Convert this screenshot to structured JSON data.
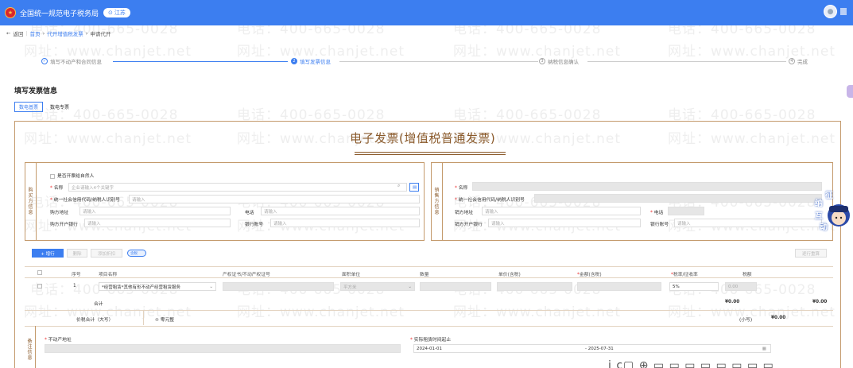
{
  "header": {
    "title": "全国统一规范电子税务局",
    "region": "江苏"
  },
  "breadcrumb": {
    "back": "返回",
    "items": [
      "首页",
      "代开增值税发票",
      "申请代开"
    ]
  },
  "steps": [
    {
      "index": "✓",
      "label": "填写不动产和合同信息"
    },
    {
      "index": "2",
      "label": "填写发票信息"
    },
    {
      "index": "3",
      "label": "纳税信息确认"
    },
    {
      "index": "4",
      "label": "完成"
    }
  ],
  "section_title": "填写发票信息",
  "tabs": {
    "active": "数电普票",
    "inactive": "数电专票"
  },
  "invoice_title": "电子发票(增值税普通发票)",
  "buyer": {
    "label": "购买方信息",
    "natural_person": "是否开票给自然人",
    "name_label": "名称",
    "name_placeholder": "企业请输入4个关键字",
    "tax_id_label": "统一社会信用代码/纳税人识别号",
    "tax_id_placeholder": "请输入",
    "address_label": "购方地址",
    "address_placeholder": "请输入",
    "phone_label": "电话",
    "phone_placeholder": "请输入",
    "bank_label": "购方开户银行",
    "bank_placeholder": "请输入",
    "account_label": "银行账号",
    "account_placeholder": "请输入"
  },
  "seller": {
    "label": "销售方信息",
    "name_label": "名称",
    "tax_id_label": "统一社会信用代码/纳税人识别号",
    "address_label": "销方地址",
    "address_placeholder": "请输入",
    "phone_label": "电话",
    "bank_label": "销方开户银行",
    "bank_placeholder": "请输入",
    "account_label": "银行账号",
    "account_placeholder": "请输入"
  },
  "toolbar": {
    "add": "+ 增行",
    "delete": "删除",
    "add_discount": "添加折扣",
    "tax_included": "含税",
    "batch": "逐行重算"
  },
  "table": {
    "headers": [
      "序号",
      "项目名称",
      "产权证书/不动产权证号",
      "面积单位",
      "数量",
      "单价(含税)",
      "金额(含税)",
      "税率/征收率",
      "税额"
    ],
    "row": {
      "index": "1",
      "item": "*经营租赁*其他有形不动产经营租赁服务",
      "unit": "平方米",
      "rate": "5%",
      "tax_amount": "0.00"
    },
    "total_label": "合计",
    "total_amount": "¥0.00",
    "total_tax": "¥0.00",
    "grand_label": "价税合计（大写）",
    "grand_uppercase": "零元整",
    "small_label": "(小写)",
    "grand_small": "¥0.00"
  },
  "remarks": {
    "label": "备注信息",
    "property_label": "不动产地址",
    "period_label": "实际租赁时间起止",
    "start": "2024-01-01",
    "end": "- 2025-07-31"
  },
  "watermark": {
    "phone": "电话：400-665-0028",
    "site": "网址：www.chanjet.net"
  },
  "assistant": {
    "text1": "征",
    "text2": "纳",
    "text3": "互",
    "text4": "动"
  },
  "bottom_fragment": "j c▢ ⊕ ▭ ▭ ▭ ▭ ▭ ▭ ▭ ▭"
}
